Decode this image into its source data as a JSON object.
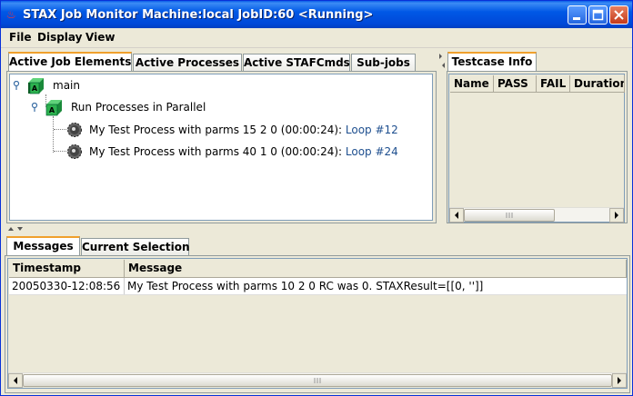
{
  "window": {
    "title": "STAX Job Monitor Machine:local JobID:60  <Running>"
  },
  "menu": [
    "File",
    "Display",
    "View"
  ],
  "top_tabs": [
    {
      "label": "Active Job Elements",
      "active": true
    },
    {
      "label": "Active Processes",
      "active": false
    },
    {
      "label": "Active STAFCmds",
      "active": false
    },
    {
      "label": "Sub-jobs",
      "active": false
    }
  ],
  "tree": {
    "root": "main",
    "child": "Run Processes in Parallel",
    "leaves": [
      {
        "text": "My Test Process with parms 15 2 0  (00:00:24):",
        "loop": "Loop #12"
      },
      {
        "text": "My Test Process with parms 40 1 0  (00:00:24):",
        "loop": "Loop #24"
      }
    ]
  },
  "testcase_tab": "Testcase Info",
  "testcase_columns": [
    "Name",
    "PASS",
    "FAIL",
    "Duration"
  ],
  "bottom_tabs": [
    {
      "label": "Messages",
      "active": true
    },
    {
      "label": "Current Selection",
      "active": false
    }
  ],
  "messages": {
    "columns": [
      "Timestamp",
      "Message"
    ],
    "rows": [
      {
        "timestamp": "20050330-12:08:56",
        "message": "My Test Process with parms 10 2 0 RC was 0.  STAXResult=[[0, '']]"
      }
    ]
  },
  "colors": {
    "titlebar": "#0058e6",
    "tab_accent": "#f0a02c",
    "cube_green": "#1a8a3a",
    "link_blue": "#1e4f8f"
  },
  "icons": [
    "java-app-icon",
    "minimize-icon",
    "maximize-icon",
    "close-icon",
    "cube-icon",
    "gear-icon",
    "tree-expander-icon"
  ]
}
